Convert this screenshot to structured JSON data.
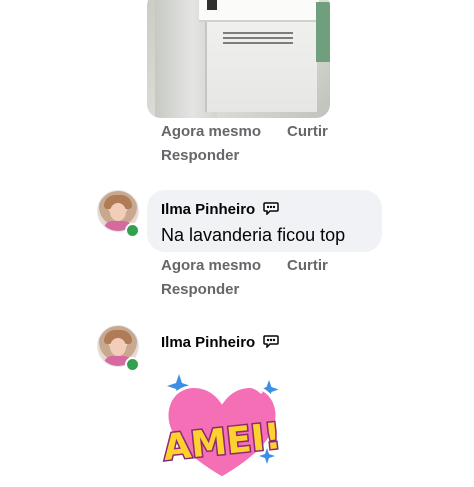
{
  "comments": [
    {
      "time": "Agora mesmo",
      "like": "Curtir",
      "reply": "Responder"
    },
    {
      "author": "Ilma Pinheiro",
      "text": "Na lavanderia ficou top",
      "time": "Agora mesmo",
      "like": "Curtir",
      "reply": "Responder"
    },
    {
      "author": "Ilma Pinheiro",
      "sticker": "AMEI!"
    }
  ],
  "colors": {
    "meta": "#65676b",
    "bubble": "#f0f2f5",
    "online": "#31a24c",
    "sticker_heart": "#f46fb6",
    "sticker_text": "#ffd12e"
  },
  "icons": [
    "top-fan-badge-icon",
    "online-status-icon"
  ]
}
